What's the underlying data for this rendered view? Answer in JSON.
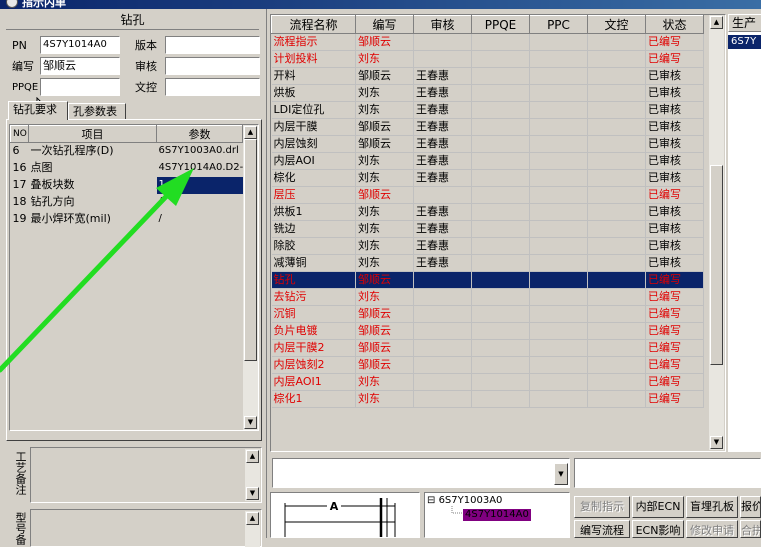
{
  "window": {
    "title": "指示内单"
  },
  "header": {
    "section_title": "钻孔",
    "pn_label": "PN",
    "pn_value": "4S7Y1014A0",
    "version_label": "版本",
    "version_value": "",
    "writer_label": "编写",
    "writer_value": "邹顺云",
    "review_label": "审核",
    "review_value": "",
    "ppqe_label": "PPQE",
    "ppqe_value": "",
    "doc_label": "文控",
    "doc_value": ""
  },
  "tabs": [
    {
      "label": "钻孔要求"
    },
    {
      "label": "孔参数表"
    }
  ],
  "param_table": {
    "headers": {
      "no": "NO",
      "item": "项目",
      "param": "参数"
    },
    "rows": [
      {
        "no": "6",
        "item": "一次钻孔程序(D)",
        "param": "6S7Y1003A0.drl"
      },
      {
        "no": "16",
        "item": "点图",
        "param": "4S7Y1014A0.D2-"
      },
      {
        "no": "17",
        "item": "叠板块数",
        "param": "1"
      },
      {
        "no": "18",
        "item": "钻孔方向",
        "param": "/"
      },
      {
        "no": "19",
        "item": "最小焊环宽(mil)",
        "param": "/"
      }
    ]
  },
  "side_labels": {
    "process_note": "工艺备注",
    "model_note": "型号备"
  },
  "process_table": {
    "headers": {
      "name": "流程名称",
      "code": "编写",
      "review": "审核",
      "ppqe": "PPQE",
      "ppc": "PPC",
      "doc": "文控",
      "status": "状态"
    },
    "rows": [
      {
        "name": "流程指示",
        "code": "邹顺云",
        "review": "",
        "status": "已编写",
        "red": true
      },
      {
        "name": "计划投料",
        "code": "刘东",
        "review": "",
        "status": "已编写",
        "red": true
      },
      {
        "name": "开料",
        "code": "邹顺云",
        "review": "王春惠",
        "status": "已审核",
        "red": false
      },
      {
        "name": "烘板",
        "code": "刘东",
        "review": "王春惠",
        "status": "已审核",
        "red": false
      },
      {
        "name": "LDI定位孔",
        "code": "刘东",
        "review": "王春惠",
        "status": "已审核",
        "red": false
      },
      {
        "name": "内层干膜",
        "code": "邹顺云",
        "review": "王春惠",
        "status": "已审核",
        "red": false
      },
      {
        "name": "内层蚀刻",
        "code": "邹顺云",
        "review": "王春惠",
        "status": "已审核",
        "red": false
      },
      {
        "name": "内层AOI",
        "code": "刘东",
        "review": "王春惠",
        "status": "已审核",
        "red": false
      },
      {
        "name": "棕化",
        "code": "刘东",
        "review": "王春惠",
        "status": "已审核",
        "red": false
      },
      {
        "name": "层压",
        "code": "邹顺云",
        "review": "",
        "status": "已编写",
        "red": true
      },
      {
        "name": "烘板1",
        "code": "刘东",
        "review": "王春惠",
        "status": "已审核",
        "red": false
      },
      {
        "name": "铣边",
        "code": "刘东",
        "review": "王春惠",
        "status": "已审核",
        "red": false
      },
      {
        "name": "除胶",
        "code": "刘东",
        "review": "王春惠",
        "status": "已审核",
        "red": false
      },
      {
        "name": "减薄铜",
        "code": "刘东",
        "review": "王春惠",
        "status": "已审核",
        "red": false
      },
      {
        "name": "钻孔",
        "code": "邹顺云",
        "review": "",
        "status": "已编写",
        "red": true,
        "selected": true
      },
      {
        "name": "去钻污",
        "code": "刘东",
        "review": "",
        "status": "已编写",
        "red": true
      },
      {
        "name": "沉铜",
        "code": "邹顺云",
        "review": "",
        "status": "已编写",
        "red": true
      },
      {
        "name": "负片电镀",
        "code": "邹顺云",
        "review": "",
        "status": "已编写",
        "red": true
      },
      {
        "name": "内层干膜2",
        "code": "邹顺云",
        "review": "",
        "status": "已编写",
        "red": true
      },
      {
        "name": "内层蚀刻2",
        "code": "邹顺云",
        "review": "",
        "status": "已编写",
        "red": true
      },
      {
        "name": "内层AOI1",
        "code": "刘东",
        "review": "",
        "status": "已编写",
        "red": true
      },
      {
        "name": "棕化1",
        "code": "刘东",
        "review": "",
        "status": "已编写",
        "red": true
      }
    ]
  },
  "right_panel": {
    "header": "生产",
    "item": "6S7Y"
  },
  "tree": {
    "root": "6S7Y1003A0",
    "child": "4S7Y1014A0"
  },
  "diagram": {
    "label": "A"
  },
  "buttons": {
    "copy_instruction": "复制指示",
    "internal_ecn": "内部ECN",
    "blind_hole": "盲埋孔板",
    "report": "报价",
    "write_process": "编写流程",
    "ecn_impact": "ECN影响",
    "change_request": "修改申请",
    "merge": "合拼"
  },
  "colors": {
    "selection": "#0a246a",
    "pending_text": "#e00000",
    "annotation_arrow": "#22dd22",
    "tree_highlight": "#800080"
  },
  "icons": [
    "app-icon",
    "scroll-up-icon",
    "scroll-down-icon",
    "dropdown-arrow-icon",
    "tree-connector-icon",
    "mouse-cursor-icon",
    "annotation-arrow-icon"
  ]
}
